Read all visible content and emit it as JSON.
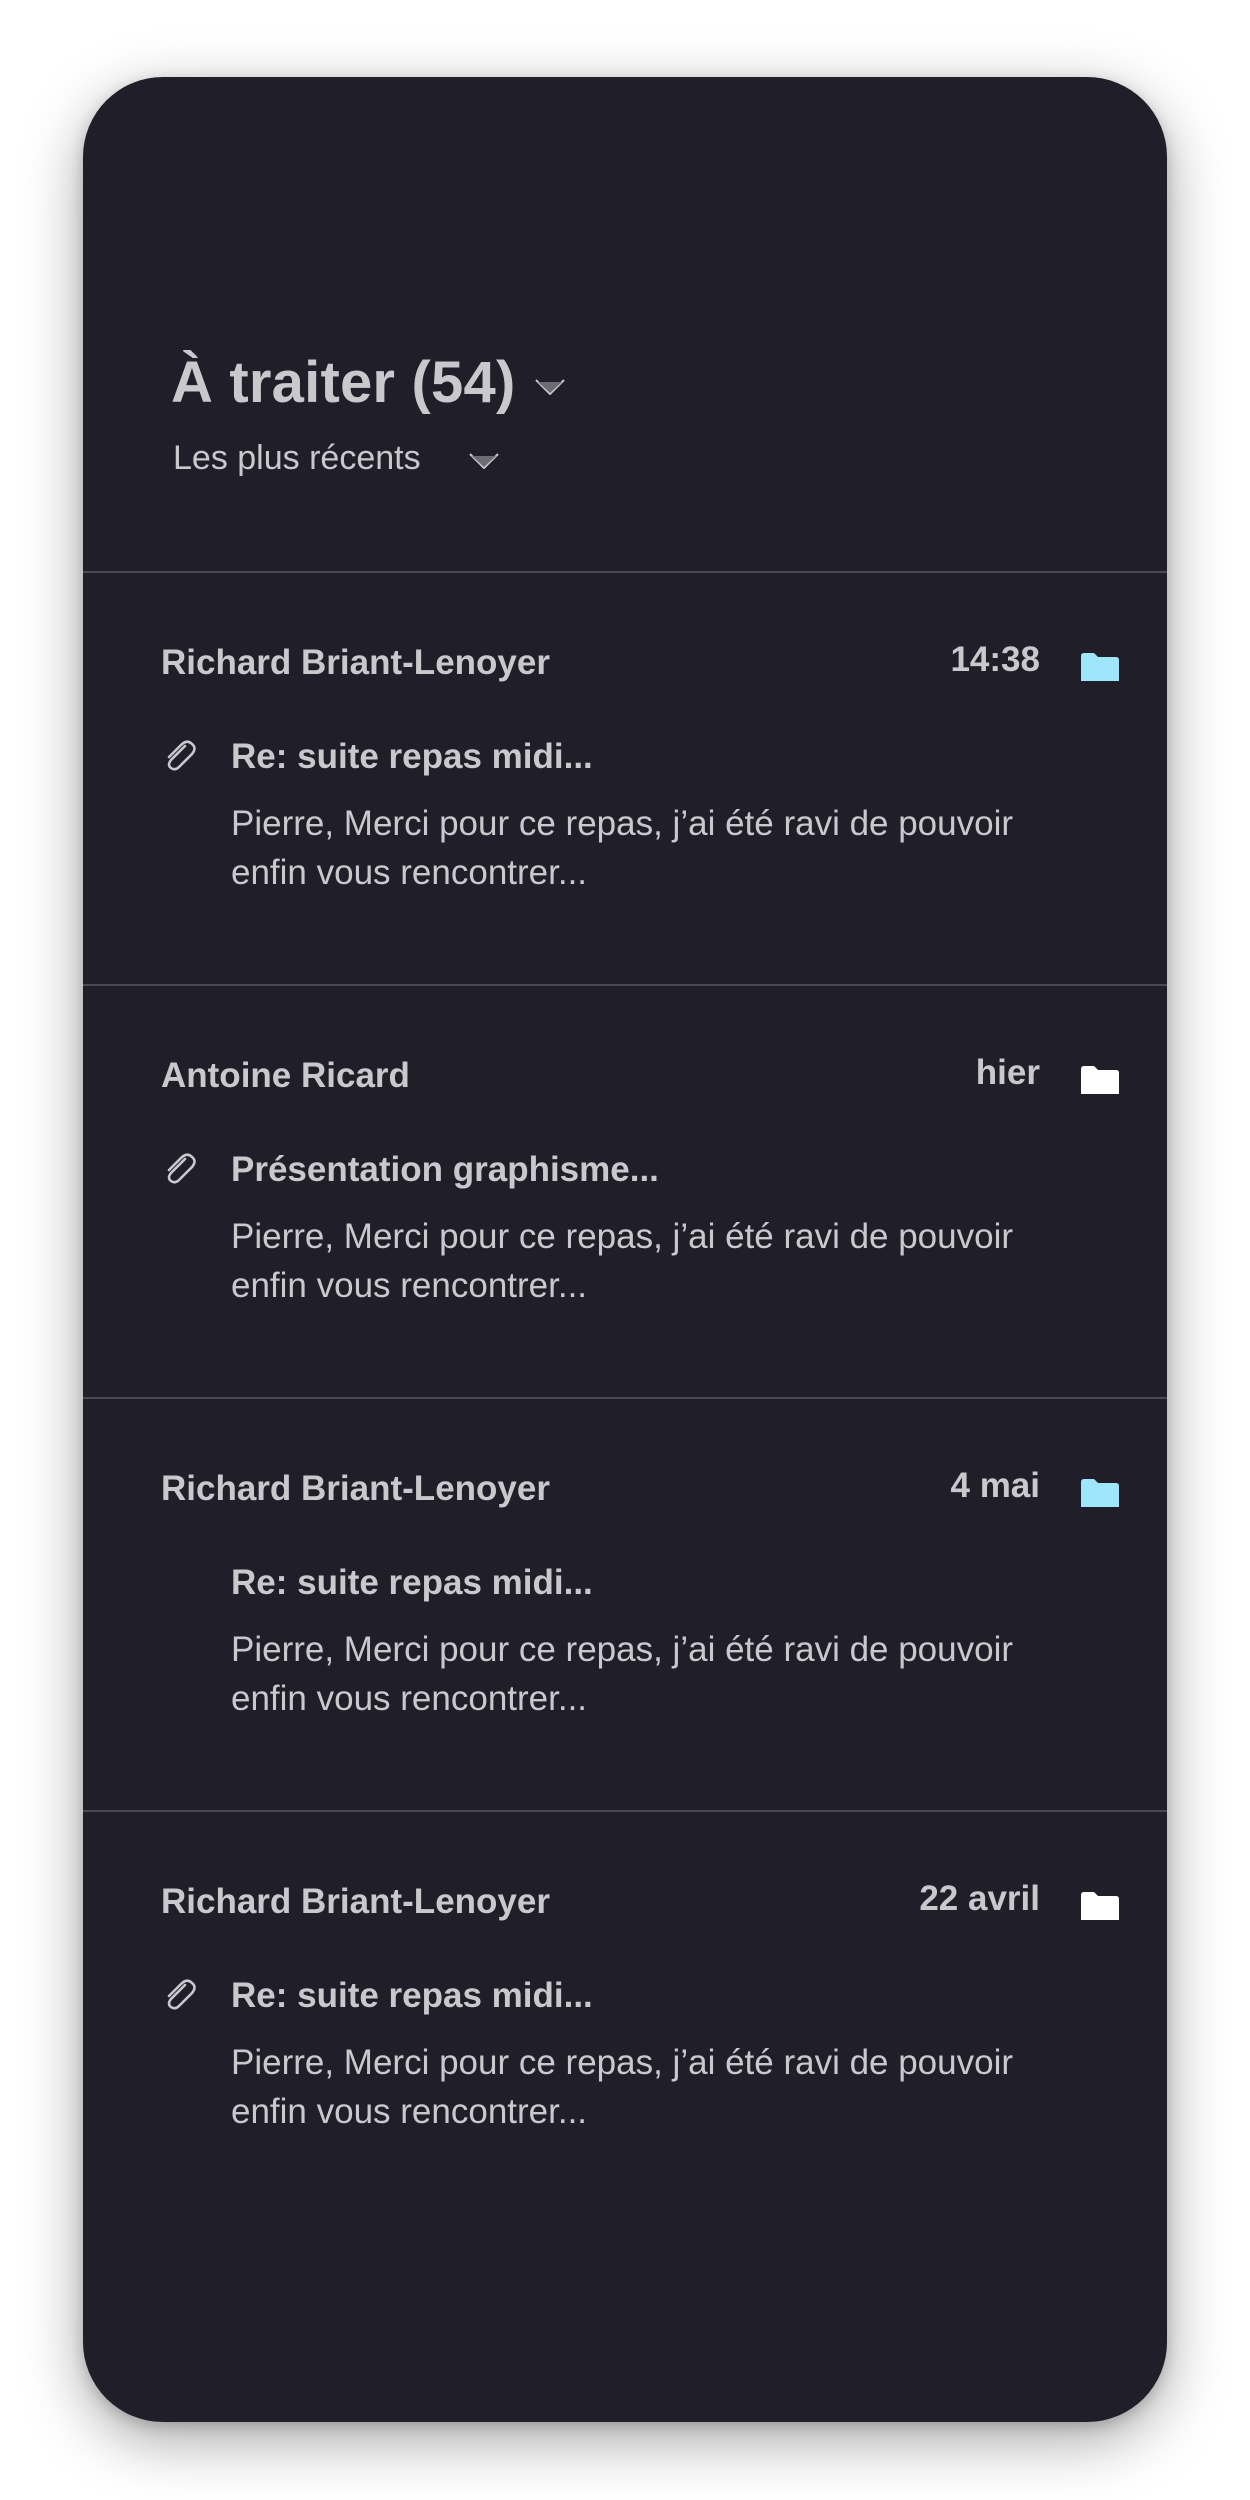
{
  "header": {
    "title": "À traiter (54)",
    "sort_label": "Les plus récents"
  },
  "colors": {
    "background": "#201e28",
    "text": "#c9c8cd",
    "divider": "#4b4953",
    "folder_highlight": "#9fe6fb",
    "folder_default": "#ffffff"
  },
  "emails": [
    {
      "sender": "Richard Briant-Lenoyer",
      "date": "14:38",
      "subject": "Re: suite repas midi...",
      "preview": "Pierre, Merci pour ce repas, j’ai été ravi de pouvoir enfin vous rencontrer...",
      "has_attachment": true,
      "folder_color": "#9fe6fb",
      "folder_icon": "folder-icon"
    },
    {
      "sender": "Antoine Ricard",
      "date": "hier",
      "subject": "Présentation graphisme...",
      "preview": "Pierre, Merci pour ce repas, j’ai été ravi de pouvoir enfin vous rencontrer...",
      "has_attachment": true,
      "folder_color": "#ffffff",
      "folder_icon": "folder-icon"
    },
    {
      "sender": "Richard Briant-Lenoyer",
      "date": "4 mai",
      "subject": "Re: suite repas midi...",
      "preview": "Pierre, Merci pour ce repas, j’ai été ravi de pouvoir enfin vous rencontrer...",
      "has_attachment": false,
      "folder_color": "#9fe6fb",
      "folder_icon": "folder-icon"
    },
    {
      "sender": "Richard Briant-Lenoyer",
      "date": "22 avril",
      "subject": "Re: suite repas midi...",
      "preview": "Pierre, Merci pour ce repas, j’ai été ravi de pouvoir enfin vous rencontrer...",
      "has_attachment": true,
      "folder_color": "#ffffff",
      "folder_icon": "folder-icon"
    }
  ]
}
